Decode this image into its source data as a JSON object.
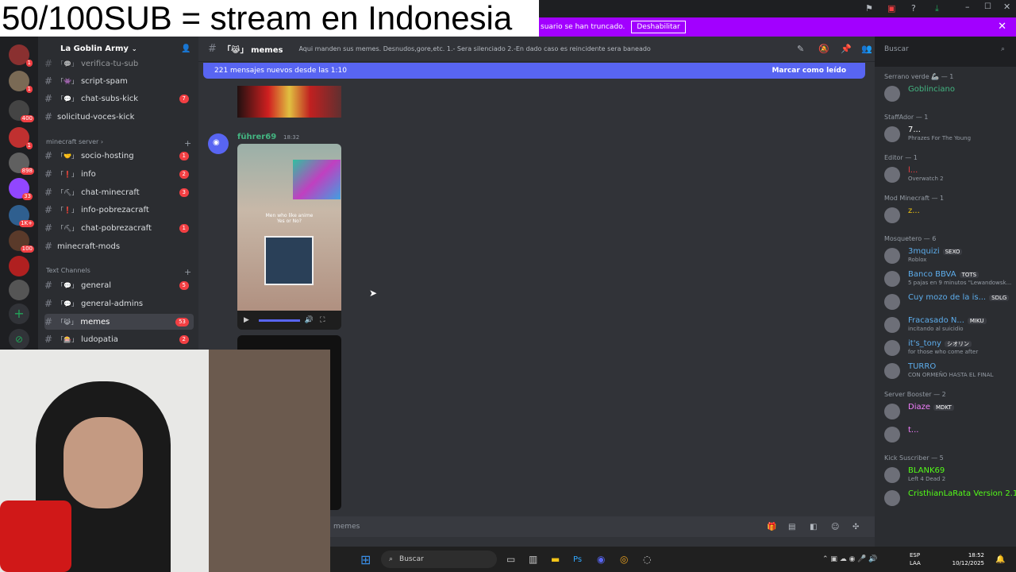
{
  "overlay": {
    "title": "50/100SUB  = stream en Indonesia"
  },
  "notice": {
    "text": "suario se han truncado.",
    "button": "Deshabilitar",
    "close": "✕"
  },
  "guild": {
    "name": "La Goblin Army"
  },
  "channels": [
    {
      "name": "verifica-tu-sub",
      "emoji": "「💬」",
      "count": ""
    },
    {
      "name": "script-spam",
      "emoji": "「👾」",
      "count": ""
    },
    {
      "name": "chat-subs-kick",
      "emoji": "「💬」",
      "count": "7"
    },
    {
      "name": "solicitud-voces-kick",
      "emoji": "",
      "count": ""
    }
  ],
  "categories": [
    {
      "name": "minecraft server ›"
    },
    {
      "name": "Text Channels"
    }
  ],
  "minecraft_channels": [
    {
      "name": "socio-hosting",
      "emoji": "「🤝」",
      "count": "1"
    },
    {
      "name": "info",
      "emoji": "「❗」",
      "count": "2"
    },
    {
      "name": "chat-minecraft",
      "emoji": "「⛏」",
      "count": "3"
    },
    {
      "name": "info-pobrezacraft",
      "emoji": "「❗」",
      "count": ""
    },
    {
      "name": "chat-pobrezacraft",
      "emoji": "「⛏」",
      "count": "1"
    },
    {
      "name": "minecraft-mods",
      "emoji": "",
      "count": ""
    }
  ],
  "text_channels": [
    {
      "name": "general",
      "emoji": "「💬」",
      "count": "5"
    },
    {
      "name": "general-admins",
      "emoji": "「💬」",
      "count": ""
    },
    {
      "name": "memes",
      "emoji": "「😹」",
      "count": "53"
    },
    {
      "name": "ludopatia",
      "emoji": "「🎰」",
      "count": "2"
    }
  ],
  "channel_header": {
    "name": "「😹」 memes",
    "topic": "Aqui manden sus memes. Desnudos,gore,etc. 1.- Sera silenciado 2.-En dado caso es reincidente sera baneado"
  },
  "search": {
    "placeholder": "Buscar"
  },
  "new_messages": {
    "text": "221 mensajes nuevos desde las 1:10",
    "mark_read": "Marcar como leído"
  },
  "message": {
    "author": "führer69",
    "time": "18:32",
    "caption_line1": "Men who like anime",
    "caption_line2": "Yes or No?"
  },
  "composer": {
    "placeholder": "memes"
  },
  "servers": [
    {
      "badge": "1"
    },
    {
      "badge": "1"
    },
    {
      "badge": "400"
    },
    {
      "badge": "1"
    },
    {
      "badge": "898"
    },
    {
      "badge": "33"
    },
    {
      "badge": "1K+"
    },
    {
      "badge": "100"
    }
  ],
  "members": {
    "sections": [
      {
        "title": "Serrano verde 🦾 — 1",
        "members": [
          {
            "name": "Goblinciano",
            "status": "",
            "color": "#43b581"
          }
        ]
      },
      {
        "title": "StaffAdor — 1",
        "members": [
          {
            "name": "7...",
            "status": "Phrazes For The Young",
            "color": "#ffffff"
          }
        ]
      },
      {
        "title": "Editor — 1",
        "members": [
          {
            "name": "l...",
            "status": "Overwatch 2",
            "color": "#f23f43"
          }
        ]
      },
      {
        "title": "Mod Minecraft — 1",
        "members": [
          {
            "name": "z...",
            "status": "",
            "color": "#f1c40f"
          }
        ]
      },
      {
        "title": "Mosquetero — 6",
        "members": [
          {
            "name": "3mquizi",
            "tag": "SEXO",
            "status": "Roblox",
            "color": "#5dadec"
          },
          {
            "name": "Banco BBVA",
            "tag": "TOTS",
            "status": "5 pajas en 9 minutos \"Lewandowsk...",
            "color": "#5dadec"
          },
          {
            "name": "Cuy mozo de la is...",
            "tag": "SDLG",
            "status": "",
            "color": "#5dadec"
          },
          {
            "name": "Fracasado N...",
            "tag": "MIKU",
            "status": "incitando al suicidio",
            "color": "#5dadec"
          },
          {
            "name": "it's_tony",
            "tag": "シオリン",
            "status": "for those who come after",
            "color": "#5dadec"
          },
          {
            "name": "TURRO",
            "tag": "",
            "status": "CON ORMEÑO HASTA EL FINAL",
            "color": "#5dadec"
          }
        ]
      },
      {
        "title": "Server Booster — 2",
        "members": [
          {
            "name": "Diaze",
            "tag": "MDKT",
            "status": "",
            "color": "#f47fff"
          },
          {
            "name": "t...",
            "tag": "",
            "status": "",
            "color": "#f47fff"
          }
        ]
      },
      {
        "title": "Kick Suscriber — 5",
        "members": [
          {
            "name": "BLANK69",
            "tag": "",
            "status": "Left 4 Dead 2",
            "color": "#53fc18"
          },
          {
            "name": "CristhianLaRata Version 2.1",
            "tag": "",
            "status": "",
            "color": "#53fc18"
          }
        ]
      }
    ]
  },
  "taskbar": {
    "search": "Buscar",
    "lang": "ESP",
    "lang2": "LAA",
    "time": "18:52",
    "date": "10/12/2025"
  }
}
